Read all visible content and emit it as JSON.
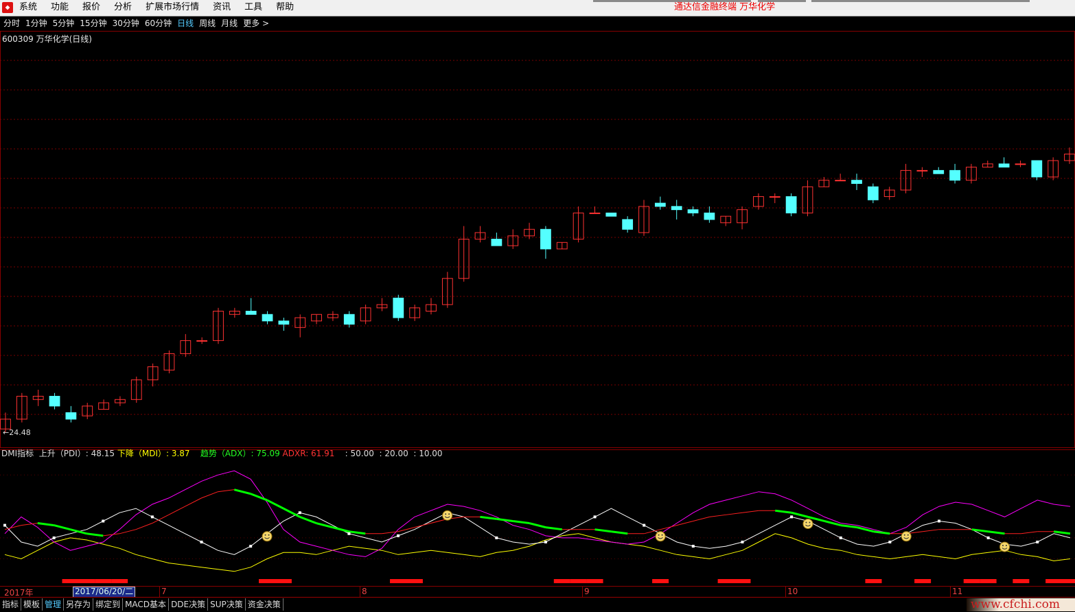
{
  "menubar": {
    "items": [
      "系统",
      "功能",
      "报价",
      "分析",
      "扩展市场行情",
      "资讯",
      "工具",
      "帮助"
    ],
    "terminal_title": "通达信金融终端   万华化学"
  },
  "periods": {
    "items": [
      "分时",
      "1分钟",
      "5分钟",
      "15分钟",
      "30分钟",
      "60分钟",
      "日线",
      "周线",
      "月线",
      "更多 >"
    ],
    "active_index": 6
  },
  "stock": {
    "title": "600309 万华化学(日线)",
    "low_marker": "←24.48"
  },
  "chart_data": {
    "type": "candlestick",
    "candles": [
      [
        24.6,
        24.9,
        25.1,
        24.5
      ],
      [
        24.9,
        25.6,
        25.7,
        24.8
      ],
      [
        25.5,
        25.6,
        25.8,
        25.3
      ],
      [
        25.6,
        25.3,
        25.7,
        25.2
      ],
      [
        25.1,
        24.9,
        25.3,
        24.8
      ],
      [
        25.0,
        25.3,
        25.4,
        24.9
      ],
      [
        25.2,
        25.4,
        25.5,
        25.2
      ],
      [
        25.4,
        25.5,
        25.6,
        25.3
      ],
      [
        25.5,
        26.1,
        26.2,
        25.4
      ],
      [
        26.1,
        26.5,
        26.6,
        25.9
      ],
      [
        26.4,
        26.9,
        27.0,
        26.3
      ],
      [
        26.9,
        27.3,
        27.5,
        26.8
      ],
      [
        27.3,
        27.3,
        27.4,
        27.2
      ],
      [
        27.3,
        28.2,
        28.3,
        27.2
      ],
      [
        28.1,
        28.2,
        28.3,
        28.0
      ],
      [
        28.2,
        28.1,
        28.6,
        28.1
      ],
      [
        28.1,
        27.9,
        28.2,
        27.8
      ],
      [
        27.9,
        27.8,
        28.0,
        27.6
      ],
      [
        27.7,
        28.0,
        28.1,
        27.4
      ],
      [
        27.9,
        28.1,
        28.1,
        27.8
      ],
      [
        28.0,
        28.1,
        28.2,
        27.9
      ],
      [
        28.1,
        27.8,
        28.2,
        27.7
      ],
      [
        27.9,
        28.3,
        28.4,
        27.8
      ],
      [
        28.3,
        28.4,
        28.6,
        28.2
      ],
      [
        28.6,
        28.0,
        28.7,
        27.9
      ],
      [
        28.0,
        28.3,
        28.4,
        27.9
      ],
      [
        28.2,
        28.4,
        28.6,
        28.1
      ],
      [
        28.4,
        29.2,
        29.4,
        28.3
      ],
      [
        29.2,
        30.4,
        30.8,
        29.1
      ],
      [
        30.4,
        30.6,
        30.8,
        30.3
      ],
      [
        30.4,
        30.2,
        30.6,
        30.2
      ],
      [
        30.2,
        30.5,
        30.7,
        30.1
      ],
      [
        30.5,
        30.7,
        30.9,
        30.4
      ],
      [
        30.7,
        30.1,
        30.8,
        29.8
      ],
      [
        30.1,
        30.3,
        30.3,
        30.1
      ],
      [
        30.4,
        31.2,
        31.4,
        30.3
      ],
      [
        31.2,
        31.2,
        31.4,
        31.2
      ],
      [
        31.2,
        31.1,
        31.2,
        31.1
      ],
      [
        31.0,
        30.7,
        31.1,
        30.6
      ],
      [
        30.6,
        31.4,
        31.6,
        30.5
      ],
      [
        31.5,
        31.4,
        31.7,
        31.3
      ],
      [
        31.4,
        31.3,
        31.6,
        31.0
      ],
      [
        31.3,
        31.2,
        31.4,
        31.1
      ],
      [
        31.2,
        31.0,
        31.4,
        30.9
      ],
      [
        30.9,
        31.1,
        31.1,
        30.8
      ],
      [
        30.9,
        31.3,
        31.4,
        30.7
      ],
      [
        31.4,
        31.7,
        31.8,
        31.3
      ],
      [
        31.7,
        31.7,
        31.8,
        31.5
      ],
      [
        31.7,
        31.2,
        31.8,
        31.1
      ],
      [
        31.2,
        32.0,
        32.2,
        31.1
      ],
      [
        32.0,
        32.2,
        32.3,
        32.0
      ],
      [
        32.2,
        32.2,
        32.4,
        32.2
      ],
      [
        32.2,
        32.1,
        32.4,
        31.9
      ],
      [
        32.0,
        31.6,
        32.1,
        31.5
      ],
      [
        31.7,
        31.9,
        32.0,
        31.6
      ],
      [
        31.9,
        32.5,
        32.7,
        31.8
      ],
      [
        32.5,
        32.5,
        32.6,
        32.3
      ],
      [
        32.5,
        32.4,
        32.6,
        32.4
      ],
      [
        32.5,
        32.2,
        32.7,
        32.1
      ],
      [
        32.2,
        32.6,
        32.7,
        32.1
      ],
      [
        32.6,
        32.7,
        32.8,
        32.6
      ],
      [
        32.7,
        32.6,
        32.9,
        32.6
      ],
      [
        32.7,
        32.7,
        32.8,
        32.6
      ],
      [
        32.8,
        32.3,
        32.8,
        32.2
      ],
      [
        32.3,
        32.8,
        32.9,
        32.2
      ],
      [
        32.8,
        33.0,
        33.2,
        32.7
      ]
    ],
    "dmi": {
      "pdi_label": "上升（PDI）",
      "pdi_value": "48.15",
      "mdi_label": "下降（MDI）",
      "mdi_value": "3.87",
      "adx_label": "趋势（ADX）",
      "adx_value": "75.09",
      "adxr_label": "ADXR",
      "adxr_value": "61.91",
      "thresholds": ": 50.00  : 20.00  : 10.00",
      "pdi": [
        22,
        30,
        25,
        18,
        14,
        16,
        18,
        24,
        31,
        36,
        39,
        43,
        47,
        50,
        52,
        48,
        37,
        24,
        18,
        16,
        14,
        12,
        11,
        15,
        24,
        30,
        33,
        36,
        35,
        33,
        30,
        26,
        24,
        21,
        20,
        20,
        19,
        18,
        17,
        18,
        22,
        27,
        32,
        36,
        38,
        40,
        42,
        41,
        38,
        34,
        30,
        27,
        26,
        24,
        22,
        25,
        31,
        35,
        37,
        36,
        33,
        30,
        34,
        38,
        36,
        35
      ],
      "mdi": [
        12,
        10,
        14,
        18,
        20,
        19,
        17,
        15,
        12,
        10,
        8,
        7,
        6,
        5,
        4,
        6,
        10,
        13,
        13,
        12,
        14,
        16,
        15,
        14,
        12,
        13,
        14,
        13,
        12,
        11,
        13,
        14,
        16,
        19,
        21,
        22,
        20,
        18,
        17,
        16,
        14,
        12,
        11,
        10,
        12,
        14,
        18,
        22,
        20,
        17,
        15,
        14,
        12,
        11,
        10,
        11,
        12,
        11,
        10,
        12,
        13,
        14,
        12,
        11,
        9,
        10
      ],
      "adx": [
        24,
        26,
        27,
        26,
        24,
        22,
        21,
        22,
        24,
        27,
        31,
        35,
        39,
        42,
        43,
        41,
        38,
        34,
        30,
        27,
        25,
        23,
        22,
        22,
        23,
        25,
        27,
        29,
        30,
        30,
        29,
        28,
        27,
        25,
        24,
        24,
        24,
        23,
        22,
        22,
        24,
        26,
        28,
        30,
        31,
        32,
        33,
        33,
        32,
        30,
        28,
        26,
        25,
        23,
        22,
        22,
        23,
        24,
        24,
        24,
        23,
        22,
        22,
        23,
        23,
        22
      ],
      "white": [
        26,
        18,
        16,
        20,
        22,
        24,
        28,
        32,
        34,
        30,
        26,
        22,
        18,
        14,
        12,
        16,
        22,
        28,
        32,
        30,
        26,
        22,
        20,
        18,
        21,
        24,
        28,
        32,
        30,
        25,
        20,
        18,
        17,
        18,
        22,
        26,
        30,
        34,
        30,
        26,
        22,
        18,
        16,
        15,
        16,
        18,
        22,
        26,
        30,
        28,
        24,
        20,
        17,
        16,
        18,
        22,
        26,
        28,
        27,
        24,
        20,
        17,
        16,
        18,
        22,
        20
      ],
      "smile_indices": [
        16,
        27,
        40,
        49,
        55,
        61
      ],
      "signal_indices": [
        4,
        5,
        6,
        7,
        16,
        17,
        24,
        25,
        34,
        35,
        36,
        40,
        44,
        45,
        53,
        56,
        59,
        60,
        62,
        64,
        65
      ]
    }
  },
  "dates": {
    "year": "2017年",
    "cursor": "2017/06/20/二",
    "months": [
      "7",
      "8",
      "9",
      "10",
      "11"
    ]
  },
  "tabs": [
    "指标",
    "模板",
    "管理",
    "另存为",
    "绑定到",
    "MACD基本",
    "DDE决策",
    "SUP决策",
    "资金决策"
  ],
  "active_tab_index": 2,
  "watermark": "www.cfchi.com",
  "colors": {
    "up": "#ff3232",
    "down": "#54ffff",
    "pdi": "#ff00ff",
    "mdi": "#ffff00",
    "adx": "#00ff00",
    "adxr": "#ff2020",
    "white": "#ffffff"
  }
}
